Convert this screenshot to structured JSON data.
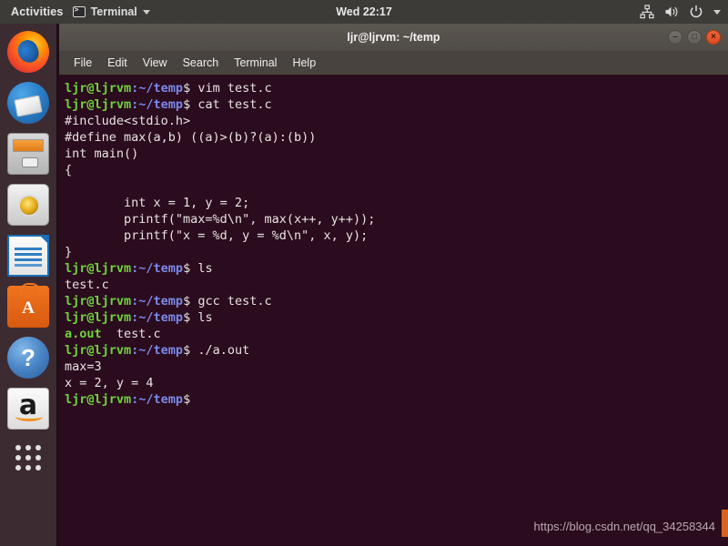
{
  "top_panel": {
    "activities_label": "Activities",
    "app_menu_label": "Terminal",
    "app_menu_icon": "terminal-icon",
    "app_menu_caret": "chevron-down-icon",
    "clock": "Wed 22:17",
    "tray_icons": [
      "network-icon",
      "volume-icon",
      "power-icon",
      "chevron-down-icon"
    ]
  },
  "dock": {
    "items": [
      {
        "name": "firefox",
        "label": "Firefox Web Browser",
        "class": "ff"
      },
      {
        "name": "thunderbird",
        "label": "Thunderbird Mail",
        "class": "tb"
      },
      {
        "name": "files",
        "label": "Files",
        "class": "fl"
      },
      {
        "name": "rhythmbox",
        "label": "Rhythmbox",
        "class": "rb"
      },
      {
        "name": "libreoffice-writer",
        "label": "LibreOffice Writer",
        "class": "lo"
      },
      {
        "name": "ubuntu-software",
        "label": "Ubuntu Software",
        "class": "us"
      },
      {
        "name": "help",
        "label": "Help",
        "class": "hp"
      },
      {
        "name": "amazon",
        "label": "Amazon",
        "class": "az"
      }
    ],
    "app_grid_label": "Show Applications"
  },
  "window": {
    "title": "ljr@ljrvm: ~/temp",
    "buttons": {
      "minimize": "–",
      "maximize": "□",
      "close": "×"
    },
    "menu": [
      "File",
      "Edit",
      "View",
      "Search",
      "Terminal",
      "Help"
    ]
  },
  "terminal": {
    "prompt_user": "ljr@ljrvm",
    "prompt_path": ":~/temp",
    "prompt_sigil": "$ ",
    "lines": [
      {
        "type": "prompt",
        "cmd": "vim test.c"
      },
      {
        "type": "prompt",
        "cmd": "cat test.c"
      },
      {
        "type": "out",
        "text": "#include<stdio.h>"
      },
      {
        "type": "out",
        "text": "#define max(a,b) ((a)>(b)?(a):(b))"
      },
      {
        "type": "out",
        "text": "int main()"
      },
      {
        "type": "out",
        "text": "{"
      },
      {
        "type": "out",
        "text": ""
      },
      {
        "type": "out",
        "text": "        int x = 1, y = 2;"
      },
      {
        "type": "out",
        "text": "        printf(\"max=%d\\n\", max(x++, y++));"
      },
      {
        "type": "out",
        "text": "        printf(\"x = %d, y = %d\\n\", x, y);"
      },
      {
        "type": "out",
        "text": "}"
      },
      {
        "type": "prompt",
        "cmd": "ls"
      },
      {
        "type": "out",
        "text": "test.c"
      },
      {
        "type": "prompt",
        "cmd": "gcc test.c"
      },
      {
        "type": "prompt",
        "cmd": "ls"
      },
      {
        "type": "ls",
        "exec": "a.out",
        "rest": "  test.c"
      },
      {
        "type": "prompt",
        "cmd": "./a.out"
      },
      {
        "type": "out",
        "text": "max=3"
      },
      {
        "type": "out",
        "text": "x = 2, y = 4"
      },
      {
        "type": "prompt",
        "cmd": ""
      }
    ]
  },
  "watermark": "https://blog.csdn.net/qq_34258344",
  "colors": {
    "panel_bg": "#3C3B37",
    "dock_bg": "#3D2B32",
    "terminal_bg": "#2B0B1E",
    "titlebar_bg": "#554F4A",
    "prompt_green": "#6FD43A",
    "prompt_blue": "#7B8AE8",
    "text_white": "#E8E4E0",
    "close_orange": "#E2541F"
  }
}
